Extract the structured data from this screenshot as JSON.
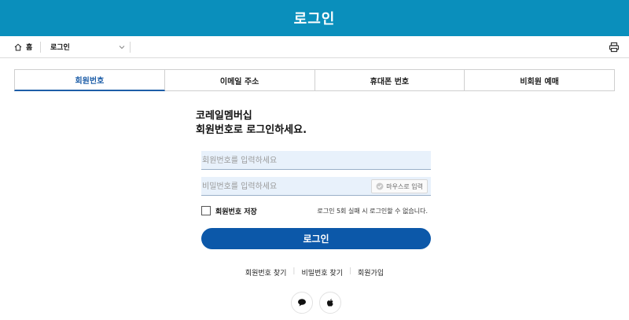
{
  "header": {
    "title": "로그인"
  },
  "breadcrumb": {
    "home_label": "홈",
    "current": "로그인"
  },
  "tabs": [
    {
      "label": "회원번호",
      "active": true
    },
    {
      "label": "이메일 주소",
      "active": false
    },
    {
      "label": "휴대폰 번호",
      "active": false
    },
    {
      "label": "비회원 예매",
      "active": false
    }
  ],
  "intro": {
    "line1": "코레일멤버십",
    "line2": "회원번호로 로그인하세요."
  },
  "form": {
    "id_placeholder": "회원번호를 입력하세요",
    "id_value": "",
    "pw_placeholder": "비밀번호를 입력하세요",
    "pw_value": "",
    "mouse_input_label": "마우스로 입력",
    "save_label": "회원번호 저장",
    "save_checked": false,
    "notice": "로그인 5회 실패 시 로그인할 수 없습니다.",
    "submit_label": "로그인"
  },
  "links": {
    "find_id": "회원번호 찾기",
    "find_pw": "비밀번호 찾기",
    "signup": "회원가입"
  },
  "social": [
    {
      "icon": "chat-bubble-icon"
    },
    {
      "icon": "apple-icon"
    }
  ],
  "colors": {
    "header_bg": "#0a8fbc",
    "primary": "#0c58a9",
    "tab_active": "#1e5ea8",
    "field_bg": "#e8f1fb"
  }
}
